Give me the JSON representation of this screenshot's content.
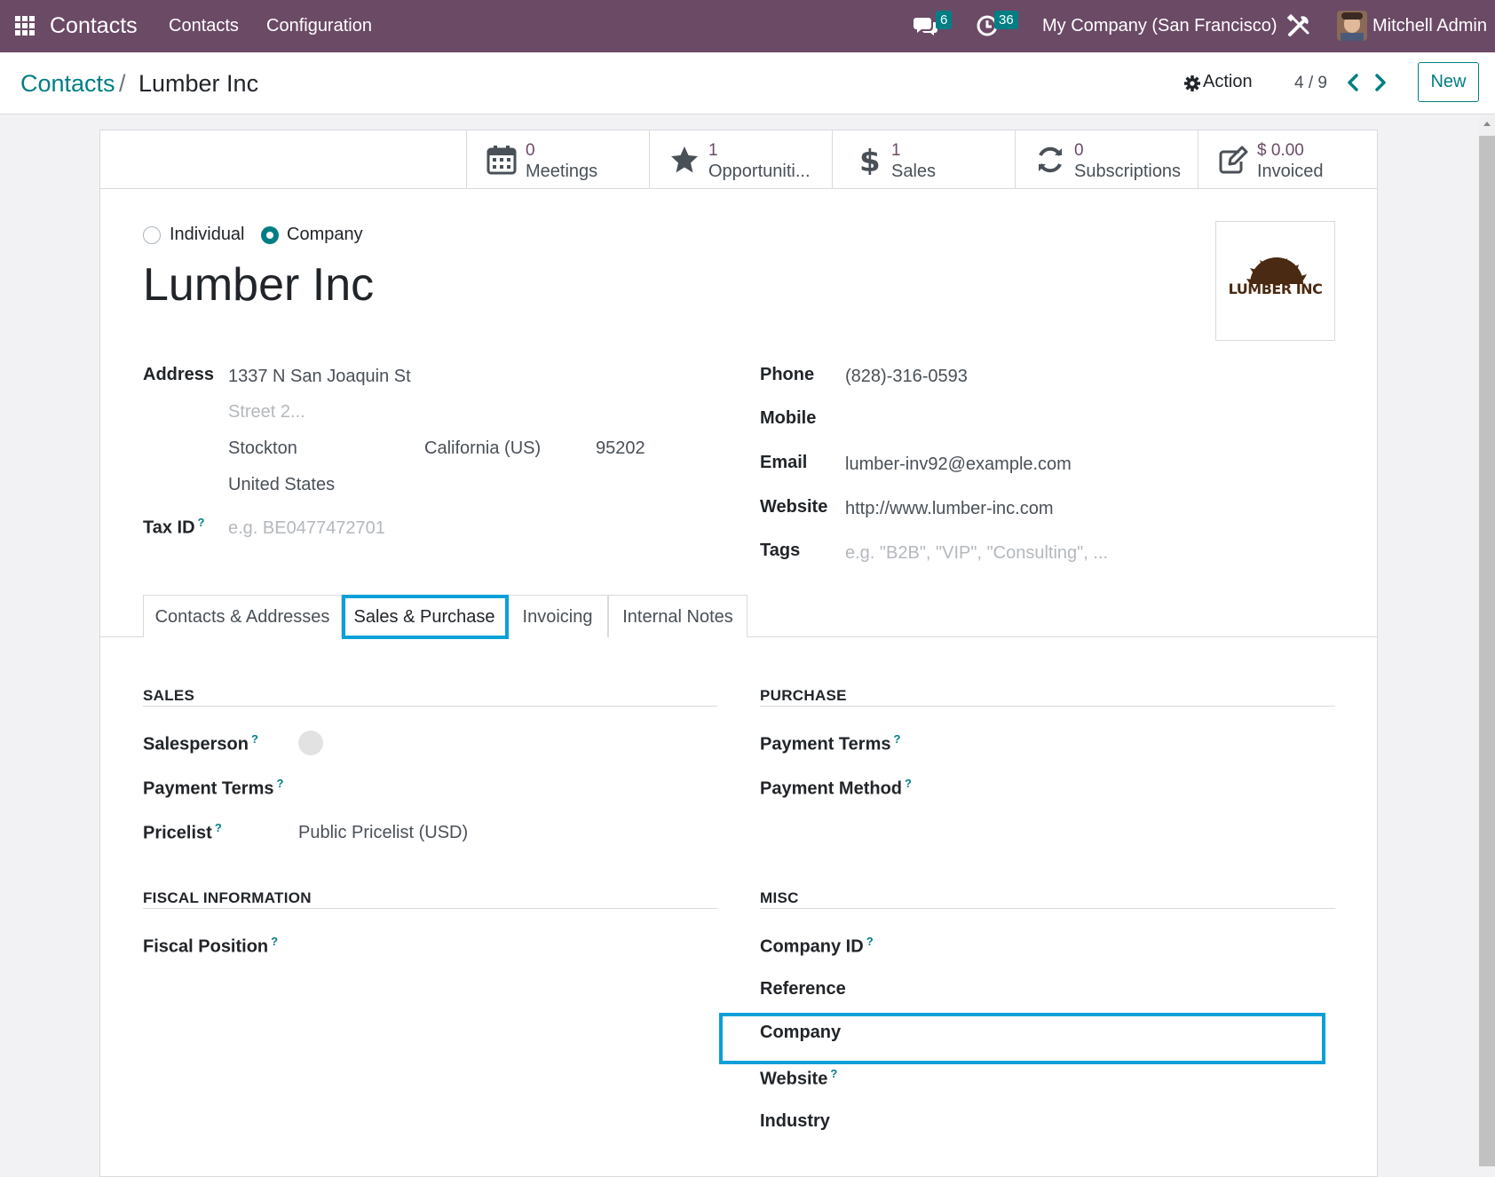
{
  "navbar": {
    "app_name": "Contacts",
    "menu": [
      "Contacts",
      "Configuration"
    ],
    "messages_count": "6",
    "activities_count": "36",
    "company": "My Company (San Francisco)",
    "user": "Mitchell Admin"
  },
  "breadcrumb": {
    "parent": "Contacts",
    "separator": "/",
    "current": "Lumber Inc"
  },
  "control": {
    "action_label": "Action",
    "pager": "4 / 9",
    "new_label": "New"
  },
  "stat_buttons": [
    {
      "value": "0",
      "label": "Meetings",
      "icon": "calendar-icon"
    },
    {
      "value": "1",
      "label": "Opportuniti...",
      "icon": "star-icon"
    },
    {
      "value": "1",
      "label": "Sales",
      "icon": "dollar-icon"
    },
    {
      "value": "0",
      "label": "Subscriptions",
      "icon": "refresh-icon"
    },
    {
      "value": "$ 0.00",
      "label": "Invoiced",
      "icon": "edit-icon"
    }
  ],
  "company_type": {
    "individual": "Individual",
    "company": "Company",
    "selected": "Company"
  },
  "name": "Lumber Inc",
  "logo_text": "LUMBER INC",
  "address": {
    "label": "Address",
    "street": "1337 N San Joaquin St",
    "street2_placeholder": "Street 2...",
    "city": "Stockton",
    "state": "California (US)",
    "zip": "95202",
    "country": "United States"
  },
  "tax_id": {
    "label": "Tax ID",
    "help": "?",
    "placeholder": "e.g. BE0477472701"
  },
  "contact": {
    "phone_label": "Phone",
    "phone": "(828)-316-0593",
    "mobile_label": "Mobile",
    "email_label": "Email",
    "email": "lumber-inv92@example.com",
    "website_label": "Website",
    "website": "http://www.lumber-inc.com",
    "tags_label": "Tags",
    "tags_placeholder": "e.g. \"B2B\", \"VIP\", \"Consulting\", ..."
  },
  "tabs": [
    "Contacts & Addresses",
    "Sales & Purchase",
    "Invoicing",
    "Internal Notes"
  ],
  "active_tab": "Sales & Purchase",
  "sales": {
    "title": "SALES",
    "salesperson_label": "Salesperson",
    "payment_terms_label": "Payment Terms",
    "pricelist_label": "Pricelist",
    "pricelist": "Public Pricelist (USD)"
  },
  "purchase": {
    "title": "PURCHASE",
    "payment_terms_label": "Payment Terms",
    "payment_method_label": "Payment Method"
  },
  "fiscal": {
    "title": "FISCAL INFORMATION",
    "fiscal_position_label": "Fiscal Position"
  },
  "misc": {
    "title": "MISC",
    "company_id_label": "Company ID",
    "reference_label": "Reference",
    "company_label": "Company",
    "website_label": "Website",
    "industry_label": "Industry"
  },
  "colors": {
    "navbar": "#6b4a66",
    "accent": "#017e84",
    "highlight": "#0aa0d8"
  }
}
